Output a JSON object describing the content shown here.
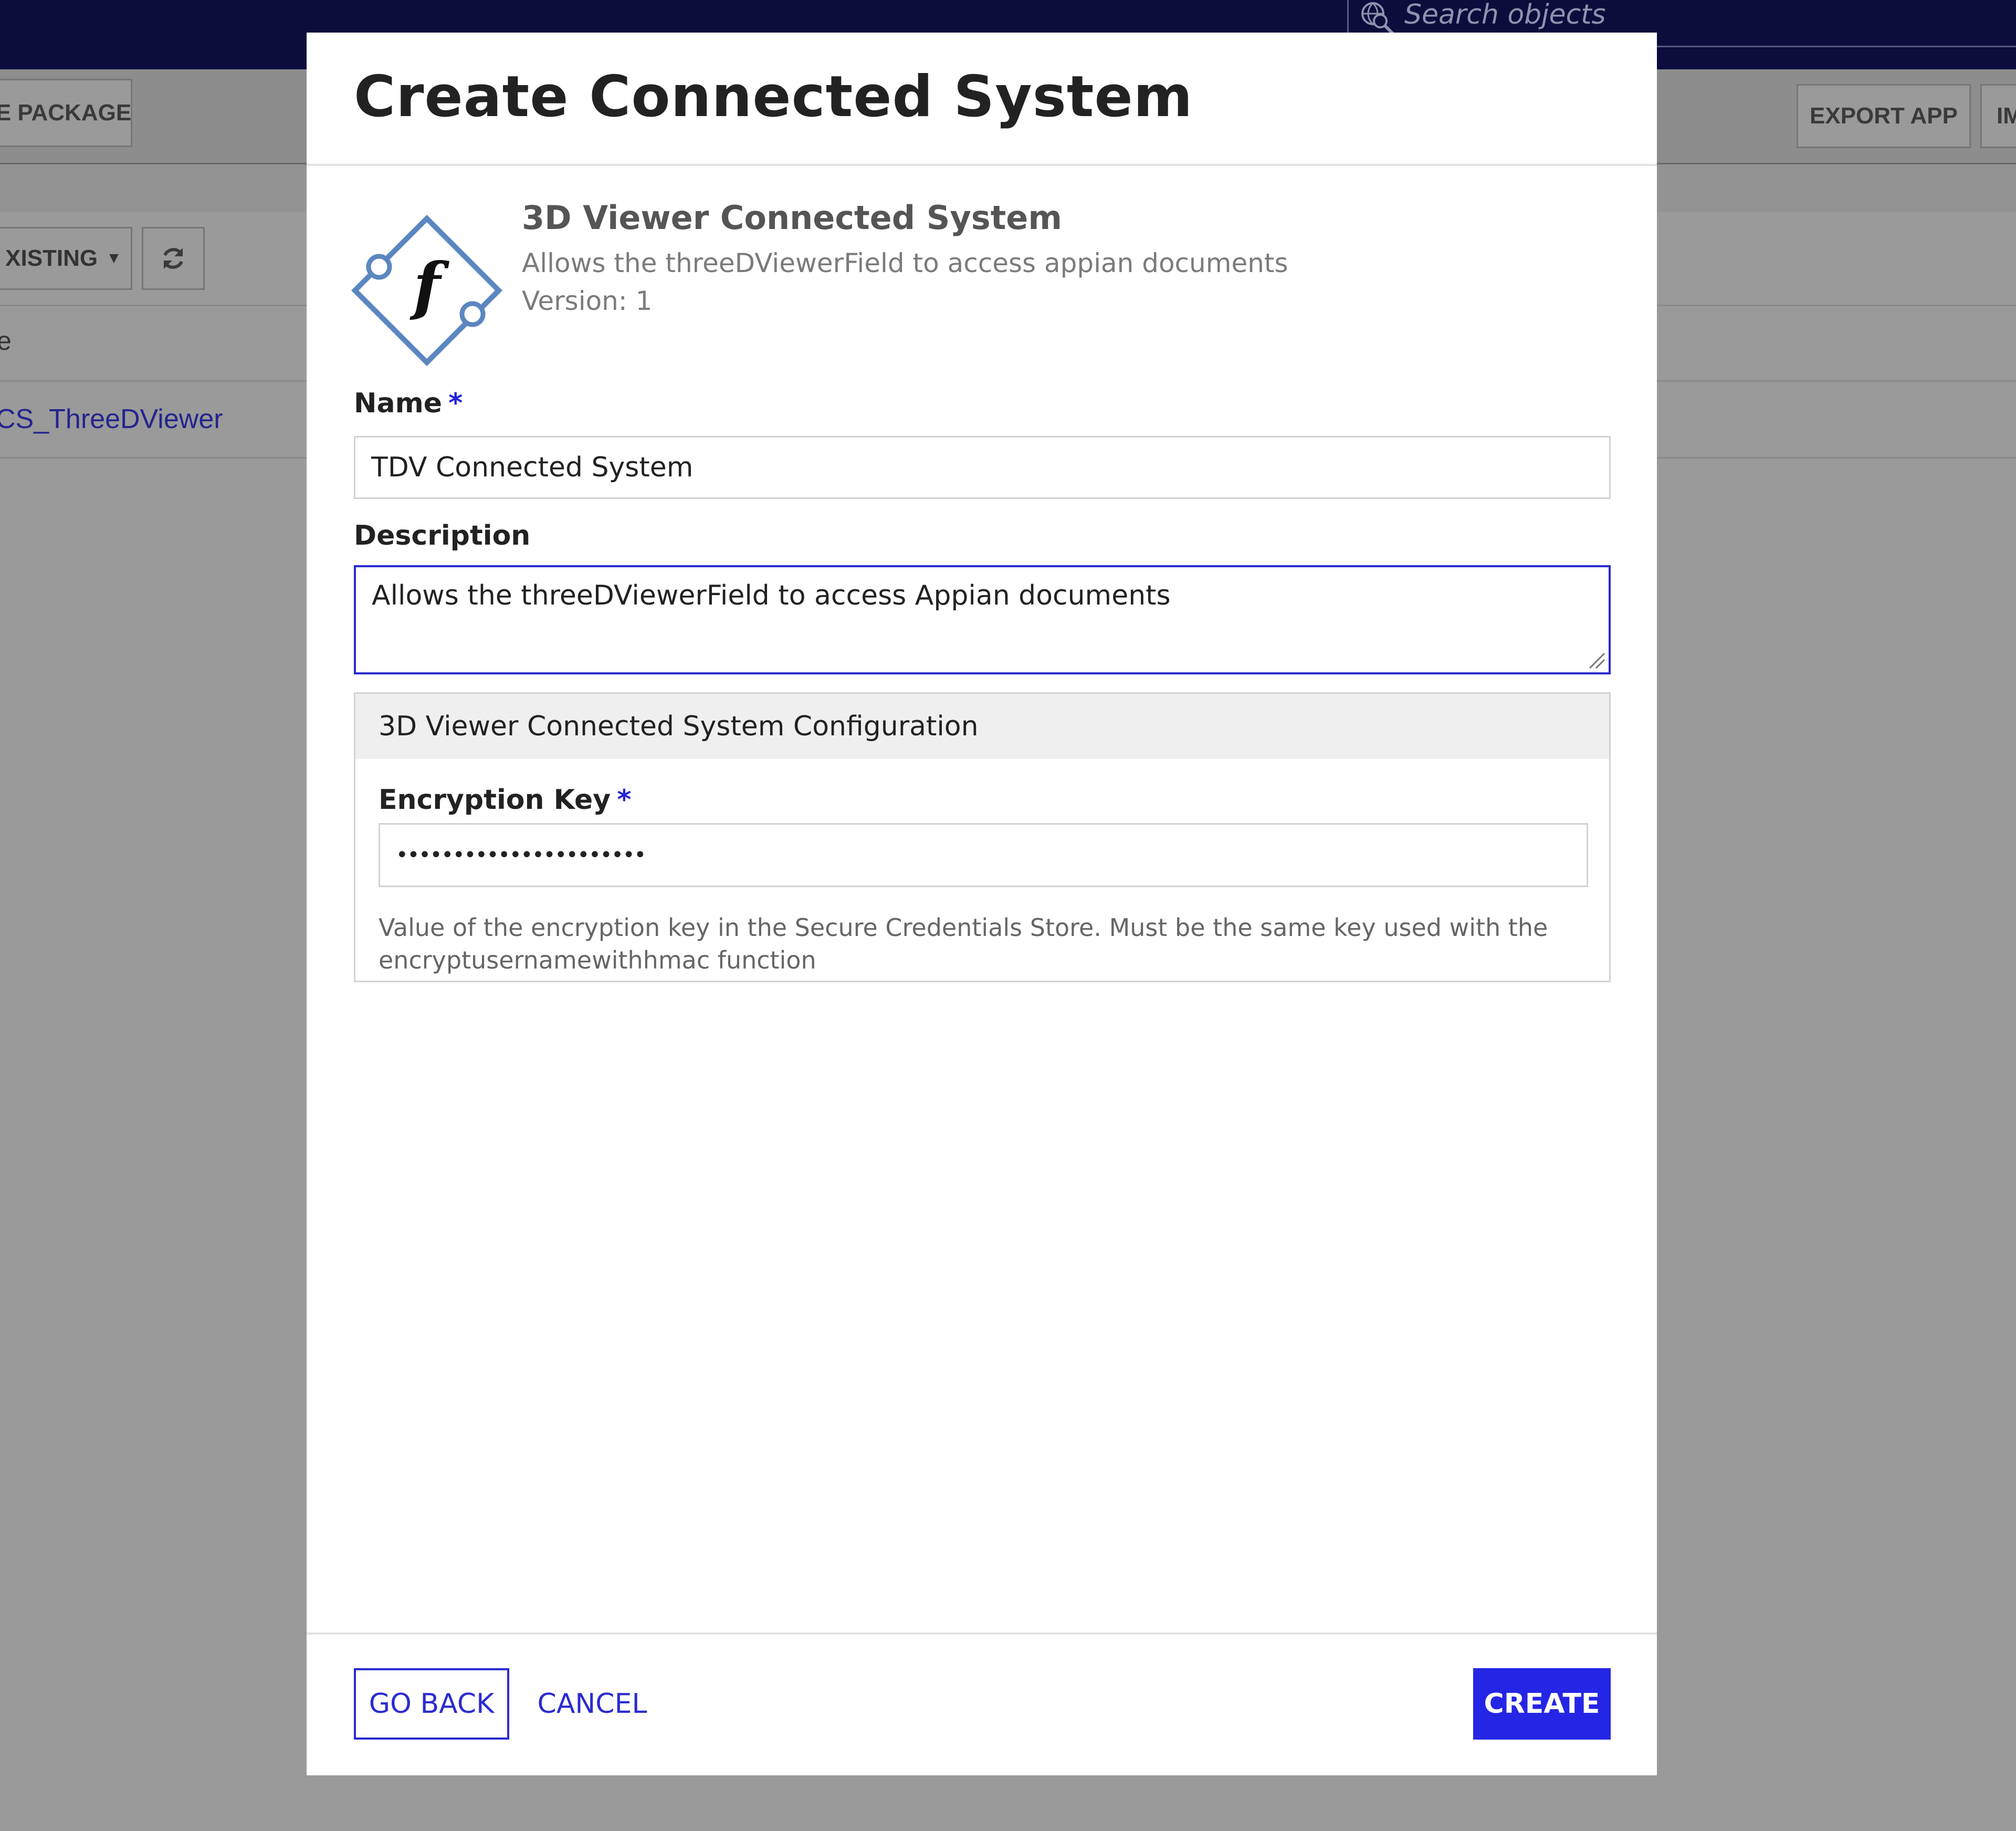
{
  "search": {
    "placeholder": "Search objects",
    "icon": "globe-search-icon"
  },
  "background": {
    "package_button": "E PACKAGE",
    "export_button": "EXPORT APP",
    "import_button": "IM",
    "existing_dropdown": "XISTING",
    "column_header": "e",
    "row_link": "CS_ThreeDViewer"
  },
  "modal": {
    "title": "Create Connected System",
    "plugin": {
      "name": "3D Viewer Connected System",
      "description": "Allows the threeDViewerField to access appian documents",
      "version": "Version: 1",
      "logo_icon": "function-diamond-icon"
    },
    "fields": {
      "name": {
        "label": "Name",
        "required_mark": "*",
        "value": "TDV Connected System"
      },
      "description": {
        "label": "Description",
        "value": "Allows the threeDViewerField to access Appian documents"
      }
    },
    "config": {
      "title": "3D Viewer Connected System Configuration",
      "encryption_key": {
        "label": "Encryption Key",
        "required_mark": "*",
        "value": "••••••••••••••••••••••",
        "help": "Value of the encryption key in the Secure Credentials Store. Must be the same key used with the encryptusernamewithhmac function"
      }
    },
    "buttons": {
      "go_back": "GO BACK",
      "cancel": "CANCEL",
      "create": "CREATE"
    }
  },
  "colors": {
    "accent": "#2b2bd0",
    "primary_button": "#2525e6",
    "top_bar": "#0c0d3c",
    "overlay": "#9a9a9a"
  }
}
